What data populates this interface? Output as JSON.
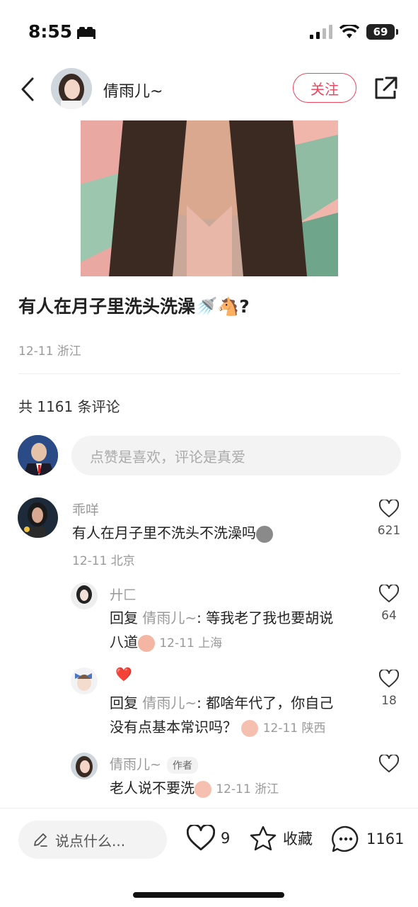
{
  "status_bar": {
    "time": "8:55",
    "battery": "69"
  },
  "header": {
    "author": "倩雨儿~",
    "follow_label": "关注"
  },
  "post": {
    "title": "有人在月子里洗头洗澡🚿🐴?",
    "meta": "12-11 浙江",
    "comment_count_text": "共 1161 条评论",
    "comment_placeholder": "点赞是喜欢，评论是真爱"
  },
  "comments": [
    {
      "name": "乖咩",
      "text": "有人在月子里不洗头不洗澡吗",
      "meta": "12-11 北京",
      "likes": "621"
    }
  ],
  "replies": [
    {
      "name": "廾匚",
      "reply_prefix": "回复",
      "reply_to": "倩雨儿~",
      "text": ": 等我老了我也要胡说",
      "text2": "八道",
      "meta": "12-11 上海",
      "likes": "64"
    },
    {
      "name": "❤️",
      "reply_prefix": "回复",
      "reply_to": "倩雨儿~",
      "text": ": 都啥年代了，你自己",
      "text2": "没有点基本常识吗？",
      "meta": "12-11 陕西",
      "likes": "18"
    },
    {
      "name": "倩雨儿~",
      "tag": "作者",
      "text": "老人说不要洗",
      "meta": "12-11 浙江"
    }
  ],
  "bottom_bar": {
    "input_placeholder": "说点什么...",
    "likes": "9",
    "collect_label": "收藏",
    "comments": "1161"
  },
  "colors": {
    "accent": "#f0455e",
    "muted": "#999999"
  }
}
